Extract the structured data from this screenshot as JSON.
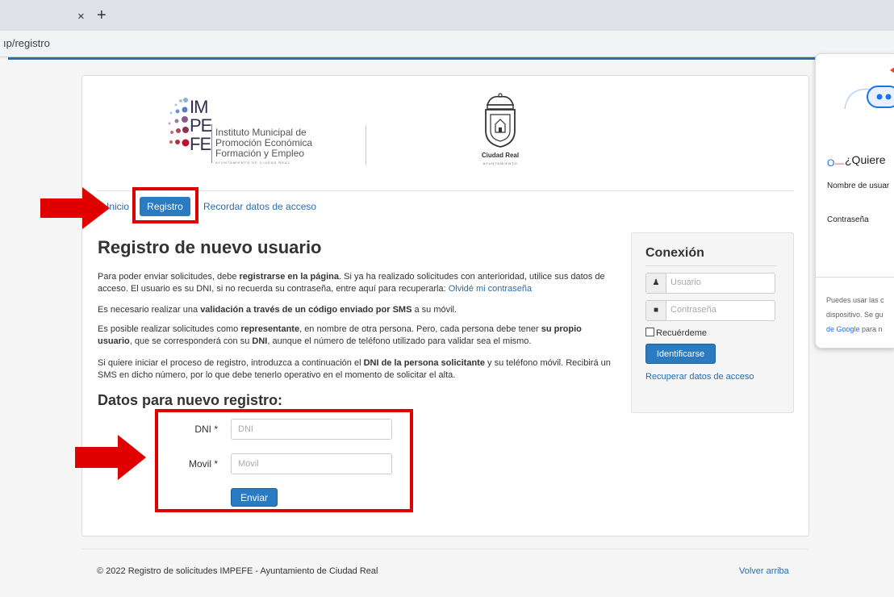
{
  "browser": {
    "tab_close": "×",
    "tab_new": "+",
    "url": "ıp/registro"
  },
  "logos": {
    "impefe_letters": [
      "IM",
      "PE",
      "FE"
    ],
    "impefe_lines": [
      "Instituto Municipal de",
      "Promoción Económica",
      "Formación y Empleo"
    ],
    "impefe_sub": "AYUNTAMIENTO DE CIUDAD REAL",
    "cr_name": "Ciudad Real",
    "cr_sub": "AYUNTAMIENTO"
  },
  "nav": {
    "inicio": "Inicio",
    "registro": "Registro",
    "recordar": "Recordar datos de acceso"
  },
  "main": {
    "title": "Registro de nuevo usuario",
    "p1_a": "Para poder enviar solicitudes, debe ",
    "p1_b": "registrarse en la página",
    "p1_c": ". Si ya ha realizado solicitudes con anterioridad, utilice sus datos de acceso. El usuario es su DNI, si no recuerda su contraseña, entre aquí para recuperarla: ",
    "p1_link": "Olvidé mi contraseña",
    "p2_a": "Es necesario realizar una ",
    "p2_b": "validación a través de un código enviado por SMS",
    "p2_c": " a su móvil.",
    "p3_a": "Es posible realizar solicitudes como ",
    "p3_b": "representante",
    "p3_c": ", en nombre de otra persona. Pero, cada persona debe tener ",
    "p3_d": "su propio usuario",
    "p3_e": ", que se corresponderá con su ",
    "p3_f": "DNI",
    "p3_g": ", aunque el número de teléfono utilizado para validar sea el mismo.",
    "p4_a": "Si quiere iniciar el proceso de registro, introduzca a continuación el ",
    "p4_b": "DNI de la persona solicitante",
    "p4_c": " y su teléfono móvil. Recibirá un SMS en dicho número, por lo que debe tenerlo operativo en el momento de solicitar el alta.",
    "subtitle": "Datos para nuevo registro:"
  },
  "form": {
    "dni_label": "DNI *",
    "dni_placeholder": "DNI",
    "movil_label": "Movil *",
    "movil_placeholder": "Movil",
    "submit": "Enviar"
  },
  "login": {
    "title": "Conexión",
    "user_placeholder": "Usuario",
    "pass_placeholder": "Contraseña",
    "remember": "Recuérdeme",
    "submit": "Identificarse",
    "recover": "Recuperar datos de acceso"
  },
  "footer": {
    "copyright": "© 2022 Registro de solicitudes IMPEFE - Ayuntamiento de Ciudad Real",
    "back_to_top": "Volver arriba"
  },
  "google_popup": {
    "title": "¿Quiere",
    "user_label": "Nombre de usuar",
    "pass_label": "Contraseña",
    "foot_1": "Puedes usar las c",
    "foot_2": "dispositivo. Se gu",
    "foot_3_link": "de Google",
    "foot_3_rest": " para n"
  },
  "colors": {
    "primary": "#2a7bbf",
    "link": "#2a6dad",
    "annotation_red": "#e00000"
  }
}
